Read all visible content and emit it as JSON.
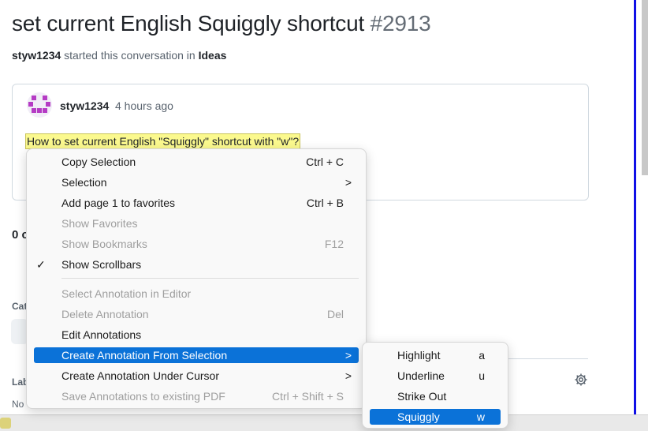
{
  "page": {
    "title": "set current English Squiggly shortcut",
    "number": "#2913",
    "author": "styw1234",
    "meta_text": "started this conversation in",
    "category": "Ideas"
  },
  "post": {
    "author": "styw1234",
    "time": "4 hours ago",
    "body": "How to set current English \"Squiggly\" shortcut with \"w\"?"
  },
  "background_partials": {
    "comments": "0 c",
    "category_label": "Cat",
    "labels_label": "Lab",
    "labels_value": "No"
  },
  "context_menu": {
    "items": [
      {
        "label": "Copy Selection",
        "shortcut": "Ctrl + C"
      },
      {
        "label": "Selection",
        "submenu": ">"
      },
      {
        "label": "Add page 1 to favorites",
        "shortcut": "Ctrl + B"
      },
      {
        "label": "Show Favorites"
      },
      {
        "label": "Show Bookmarks",
        "shortcut": "F12"
      },
      {
        "label": "Show Scrollbars",
        "check": "✓"
      },
      {
        "label": "Select Annotation in Editor"
      },
      {
        "label": "Delete Annotation",
        "shortcut": "Del"
      },
      {
        "label": "Edit Annotations"
      },
      {
        "label": "Create Annotation From Selection",
        "submenu": ">"
      },
      {
        "label": "Create Annotation Under Cursor",
        "submenu": ">"
      },
      {
        "label": "Save Annotations to existing PDF",
        "shortcut": "Ctrl + Shift + S"
      }
    ]
  },
  "submenu": {
    "items": [
      {
        "label": "Highlight",
        "key": "a"
      },
      {
        "label": "Underline",
        "key": "u"
      },
      {
        "label": "Strike Out",
        "key": ""
      },
      {
        "label": "Squiggly",
        "key": "w"
      }
    ]
  },
  "icons": {
    "settings": "gear-icon",
    "check": "check-icon",
    "submenu": "chevron-right-icon"
  },
  "colors": {
    "selection": "#0b72d8",
    "highlight": "#fbf98e",
    "avatar": "#b53bc4",
    "window_border": "#1010e6"
  }
}
